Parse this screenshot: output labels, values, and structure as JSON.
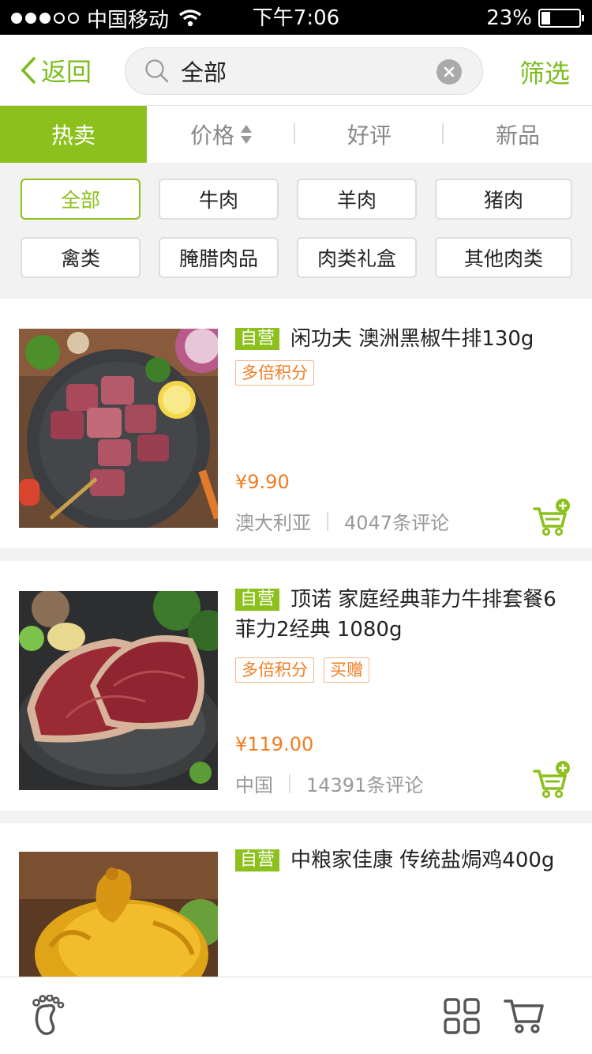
{
  "status_bar": {
    "carrier": "中国移动",
    "time": "下午7:06",
    "battery": "23%",
    "battery_level": 0.23
  },
  "header": {
    "back_label": "返回",
    "search_value": "全部",
    "filter_label": "筛选"
  },
  "sort_tabs": [
    {
      "label": "热卖",
      "active": true
    },
    {
      "label": "价格",
      "active": false
    },
    {
      "label": "好评",
      "active": false
    },
    {
      "label": "新品",
      "active": false
    }
  ],
  "categories": [
    {
      "label": "全部",
      "active": true
    },
    {
      "label": "牛肉"
    },
    {
      "label": "羊肉"
    },
    {
      "label": "猪肉"
    },
    {
      "label": "禽类"
    },
    {
      "label": "腌腊肉品"
    },
    {
      "label": "肉类礼盒"
    },
    {
      "label": "其他肉类"
    }
  ],
  "products": [
    {
      "badge": "自营",
      "title": "闲功夫 澳洲黑椒牛排130g",
      "tags": [
        "多倍积分"
      ],
      "price": "¥9.90",
      "origin": "澳大利亚",
      "reviews": "4047条评论"
    },
    {
      "badge": "自营",
      "title": "顶诺 家庭经典菲力牛排套餐6菲力2经典 1080g",
      "tags": [
        "多倍积分",
        "买赠"
      ],
      "price": "¥119.00",
      "origin": "中国",
      "reviews": "14391条评论"
    },
    {
      "badge": "自营",
      "title": "中粮家佳康 传统盐焗鸡400g",
      "tags": [],
      "price": "",
      "origin": "",
      "reviews": ""
    }
  ],
  "colors": {
    "accent": "#8cc11d",
    "price": "#f27c21"
  },
  "bottom_bar": {
    "icons": [
      "footprint-icon",
      "grid-icon",
      "cart-icon"
    ]
  }
}
